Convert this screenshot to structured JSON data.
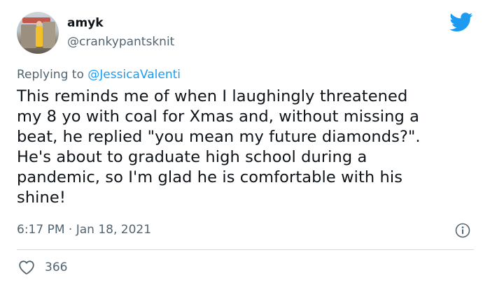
{
  "author": {
    "name": "amyk",
    "handle": "@crankypantsknit"
  },
  "reply": {
    "prefix": "Replying to ",
    "mention": "@JessicaValenti"
  },
  "tweet": {
    "text": "This reminds me of when I laughingly threatened\nmy 8 yo with coal for Xmas and, without missing a\nbeat, he replied \"you mean my future diamonds?\".\nHe's about to graduate high school during a\npandemic, so I'm glad he is comfortable with his\nshine!",
    "timestamp": "6:17 PM · Jan 18, 2021"
  },
  "engagement": {
    "likes": "366"
  },
  "icons": {
    "brand": "twitter-bird-icon",
    "info": "info-icon",
    "like": "heart-icon"
  },
  "colors": {
    "brand": "#1d9bf0",
    "secondary_text": "#536471",
    "divider": "#cfd9de"
  }
}
